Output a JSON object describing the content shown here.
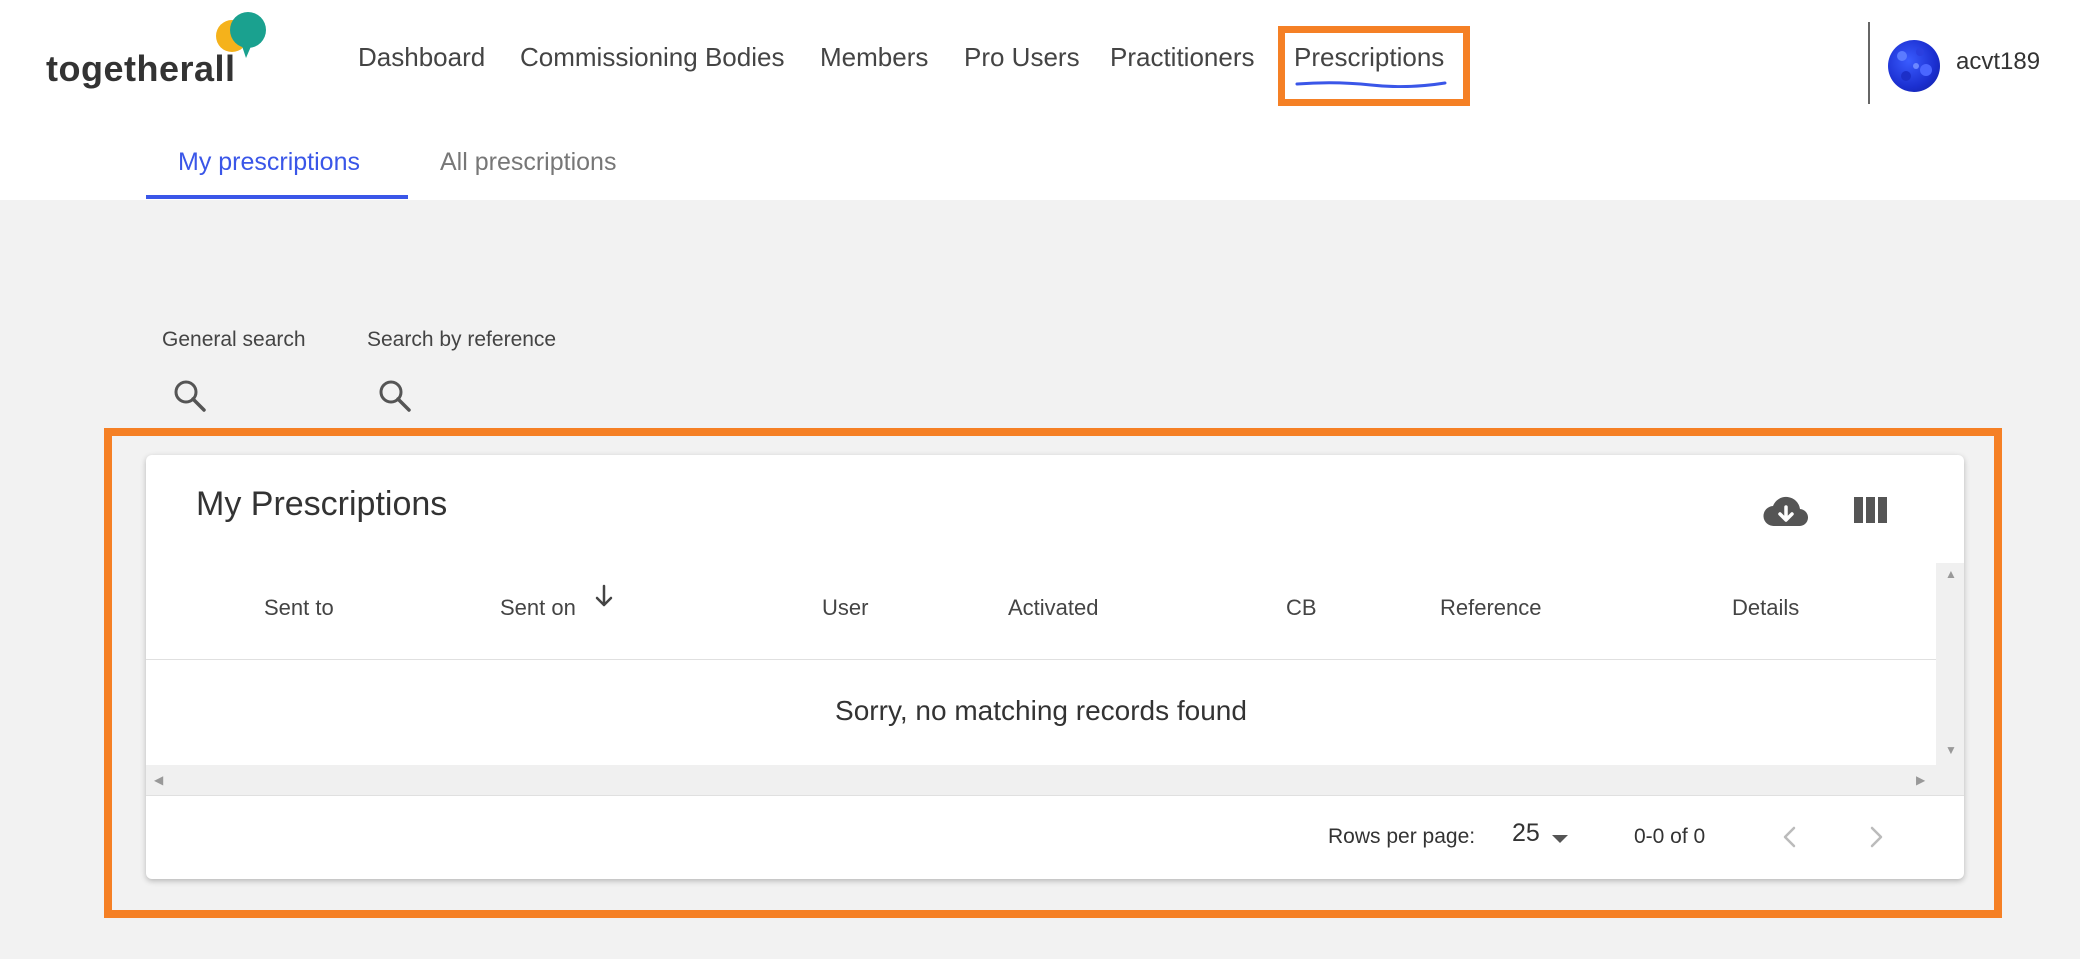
{
  "brand": {
    "name": "togetherall"
  },
  "nav": {
    "items": [
      {
        "label": "Dashboard"
      },
      {
        "label": "Commissioning Bodies"
      },
      {
        "label": "Members"
      },
      {
        "label": "Pro Users"
      },
      {
        "label": "Practitioners"
      },
      {
        "label": "Prescriptions"
      }
    ],
    "active": "Prescriptions"
  },
  "user": {
    "name": "acvt189"
  },
  "tabs": [
    {
      "label": "My prescriptions",
      "active": true
    },
    {
      "label": "All prescriptions",
      "active": false
    }
  ],
  "search": {
    "general_label": "General search",
    "reference_label": "Search by reference"
  },
  "table": {
    "title": "My Prescriptions",
    "columns": [
      "Sent to",
      "Sent on",
      "User",
      "Activated",
      "CB",
      "Reference",
      "Details"
    ],
    "sorted_column": "Sent on",
    "sort_direction": "descending",
    "empty_message": "Sorry, no matching records found",
    "rows_per_page_label": "Rows per page:",
    "rows_per_page": "25",
    "page_range": "0-0 of 0"
  },
  "icons": {
    "download": "cloud-download-icon",
    "columns": "view-columns-icon",
    "search": "search-icon"
  },
  "colors": {
    "accent": "#3a56e8",
    "highlight": "#f58025",
    "background": "#f2f2f2"
  }
}
